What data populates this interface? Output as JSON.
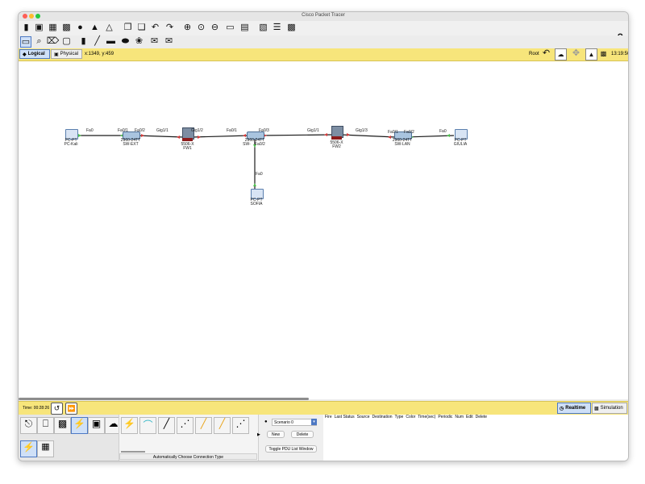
{
  "window": {
    "title": "Cisco Packet Tracer"
  },
  "menu": {
    "help": "?"
  },
  "view_tabs": {
    "logical": "Logical",
    "physical": "Physical",
    "coords": "x:1349, y:459",
    "root": "Root",
    "clock": "13:19:50"
  },
  "devices": {
    "pc_kali": {
      "model": "PC-PT",
      "name": "PC-Kali"
    },
    "sw_ext": {
      "model": "2960-24TT",
      "name": "SW-EXT"
    },
    "fw1": {
      "model": "5506-X",
      "name": "FW1"
    },
    "sw_mid": {
      "model": "2960-24TT",
      "name": "SW-"
    },
    "fw2": {
      "model": "5506-X",
      "name": "FW2"
    },
    "sw_lan": {
      "model": "2960-24TT",
      "name": "SW-LAN"
    },
    "pc_giulia": {
      "model": "PC-PT",
      "name": "GIULIA"
    },
    "pc_sofia": {
      "model": "PC-PT",
      "name": "SOFIA"
    }
  },
  "ports": {
    "kali_fa0": "Fa0",
    "swext_fa01": "Fa0/1",
    "swext_fa02": "Fa0/2",
    "fw1_gig11": "Gig1/1",
    "fw1_gig12": "Gig1/2",
    "swmid_fa01": "Fa0/1",
    "swmid_fa03": "Fa0/3",
    "swmid_fa02": "Fa0/2",
    "fw2_gig11": "Gig1/1",
    "fw2_gig13": "Gig1/3",
    "swlan_fa01": "Fa0/1",
    "swlan_fa02": "Fa0/2",
    "giulia_fa0": "Fa0",
    "sofia_fa0": "Fa0"
  },
  "time_bar": {
    "time": "Time: 00:28:26",
    "realtime": "Realtime",
    "simulation": "Simulation"
  },
  "bottom": {
    "connection_hint": "Automatically Choose Connection Type",
    "scenario": "Scenario 0",
    "new": "New",
    "delete": "Delete",
    "toggle_pdu": "Toggle PDU List Window",
    "pdu_columns": [
      "Fire",
      "Last Status",
      "Source",
      "Destination",
      "Type",
      "Color",
      "Time(sec)",
      "Periodic",
      "Num",
      "Edit",
      "Delete"
    ]
  },
  "colors": {
    "accent_yellow": "#f7e57b",
    "link": "#1a1a1a",
    "link_ok": "#4fc04f",
    "link_down": "#d43c3c"
  }
}
